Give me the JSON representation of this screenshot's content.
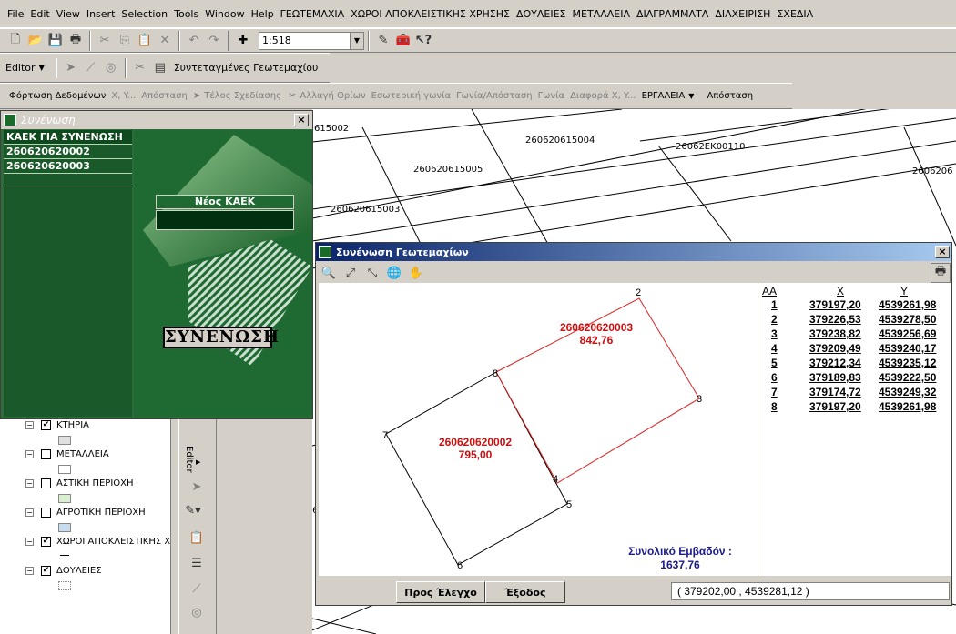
{
  "menu": [
    "File",
    "Edit",
    "View",
    "Insert",
    "Selection",
    "Tools",
    "Window",
    "Help",
    "ΓΕΩΤΕΜΑΧΙΑ",
    "ΧΩΡΟΙ ΑΠΟΚΛΕΙΣΤΙΚΗΣ ΧΡΗΣΗΣ",
    "ΔΟΥΛΕΙΕΣ",
    "ΜΕΤΑΛΛΕΙΑ",
    "ΔΙΑΓΡΑΜΜΑΤΑ",
    "ΔΙΑΧΕΙΡΙΣΗ",
    "ΣΧΕΔΙΑ"
  ],
  "toolbar": {
    "scale": "1:518",
    "editor": "Editor",
    "coords_btn": "Συντεταγμένες Γεωτεμαχίου"
  },
  "toolbar2": {
    "load": "Φόρτωση Δεδομένων",
    "xy": "X, Y...",
    "distance1": "Απόσταση",
    "end": "Τέλος Σχεδίασης",
    "change": "Αλλαγή Ορίων",
    "inner": "Εσωτερική γωνία",
    "angle_dist": "Γωνία/Απόσταση",
    "angle": "Γωνία",
    "diff": "Διαφορά X, Y...",
    "tools": "ΕΡΓΑΛΕΙΑ",
    "distance2": "Απόσταση"
  },
  "map_labels": [
    "615002",
    "260620615004",
    "26062ΕΚ00110",
    "260620615005",
    "2606206",
    "260620615003",
    "2606206"
  ],
  "toc": [
    {
      "name": "ΚΤΗΡΙΑ",
      "checked": true
    },
    {
      "name": "ΜΕΤΑΛΛΕΙΑ",
      "checked": false
    },
    {
      "name": "ΑΣΤΙΚΗ ΠΕΡΙΟΧΗ",
      "checked": false
    },
    {
      "name": "ΑΓΡΟΤΙΚΗ ΠΕΡΙΟΧΗ",
      "checked": false
    },
    {
      "name": "ΧΩΡΟΙ ΑΠΟΚΛΕΙΣΤΙΚΗΣ Χ",
      "checked": true
    },
    {
      "name": "ΔΟΥΛΕΙΕΣ",
      "checked": true
    }
  ],
  "vtool": {
    "editor": "Editor"
  },
  "merge_win": {
    "title": "Συνένωση",
    "list_header": "ΚΑΕΚ ΓΙΑ ΣΥΝΕΝΩΣΗ",
    "items": [
      "260620620002",
      "260620620003"
    ],
    "new_kaek_label": "Νέος ΚΑΕΚ",
    "new_kaek_value": "",
    "merge_btn": "ΣΥΝΕΝΩΣΗ"
  },
  "parcel_win": {
    "title": "Συνένωση Γεωτεμαχίων",
    "parcel_a": {
      "id": "260620620003",
      "area": "842,76"
    },
    "parcel_b": {
      "id": "260620620002",
      "area": "795,00"
    },
    "total_label": "Συνολικό Εμβαδόν :",
    "total_value": "1637,76",
    "check_btn": "Προς Έλεγχο",
    "exit_btn": "Έξοδος",
    "cursor_coords": "( 379202,00 , 4539281,12 )",
    "headers": [
      "AA",
      "X",
      "Y"
    ],
    "rows": [
      [
        "1",
        "379197,20",
        "4539261,98"
      ],
      [
        "2",
        "379226,53",
        "4539278,50"
      ],
      [
        "3",
        "379238,82",
        "4539256,69"
      ],
      [
        "4",
        "379209,49",
        "4539240,17"
      ],
      [
        "5",
        "379212,34",
        "4539235,12"
      ],
      [
        "6",
        "379189,83",
        "4539222,50"
      ],
      [
        "7",
        "379174,72",
        "4539249,32"
      ],
      [
        "8",
        "379197,20",
        "4539261,98"
      ]
    ]
  }
}
